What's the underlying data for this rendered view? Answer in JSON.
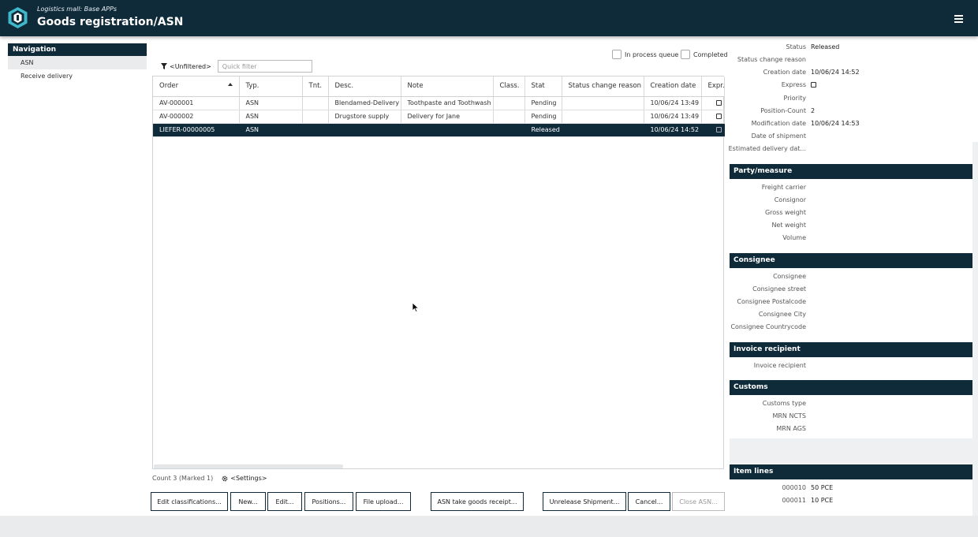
{
  "header": {
    "subtitle": "Logistics mall: Base APPs",
    "title": "Goods registration/ASN"
  },
  "navigation": {
    "heading": "Navigation",
    "items": [
      {
        "label": "ASN",
        "active": true
      },
      {
        "label": "Receive delivery",
        "active": false
      }
    ]
  },
  "filter": {
    "label": "<Unfiltered>",
    "quick_filter_placeholder": "Quick filter",
    "quick_filter_value": ""
  },
  "checkboxes": {
    "in_process_queue": {
      "label": "In process queue",
      "checked": false
    },
    "completed": {
      "label": "Completed",
      "checked": false
    }
  },
  "table": {
    "columns": [
      "Order",
      "Typ.",
      "Tnt.",
      "Desc.",
      "Note",
      "Class.",
      "Stat",
      "Status change reason",
      "Creation date",
      "Expr."
    ],
    "sort_column": "Order",
    "rows": [
      {
        "order": "AV-000001",
        "typ": "ASN",
        "tnt": "",
        "desc": "Blendamed-Delivery",
        "note": "Toothpaste and Toothwash",
        "class": "",
        "stat": "Pending",
        "reason": "",
        "created": "10/06/24 13:49",
        "express": false,
        "selected": false
      },
      {
        "order": "AV-000002",
        "typ": "ASN",
        "tnt": "",
        "desc": "Drugstore supply",
        "note": "Delivery for Jane",
        "class": "",
        "stat": "Pending",
        "reason": "",
        "created": "10/06/24 13:49",
        "express": false,
        "selected": false
      },
      {
        "order": "LIEFER-00000005",
        "typ": "ASN",
        "tnt": "",
        "desc": "",
        "note": "",
        "class": "",
        "stat": "Released",
        "reason": "",
        "created": "10/06/24 14:52",
        "express": false,
        "selected": true
      }
    ]
  },
  "count_bar": {
    "count_text": "Count 3 (Marked 1)",
    "settings_label": "<Settings>"
  },
  "buttons": {
    "edit_classifications": "Edit classifications...",
    "new": "New...",
    "edit": "Edit...",
    "positions": "Positions...",
    "file_upload": "File upload...",
    "asn_take_goods": "ASN take goods receipt...",
    "unrelease": "Unrelease Shipment...",
    "cancel": "Cancel...",
    "close_asn": "Close ASN..."
  },
  "details": {
    "status": {
      "label": "Status",
      "value": "Released"
    },
    "status_change_reason": {
      "label": "Status change reason",
      "value": ""
    },
    "creation_date": {
      "label": "Creation date",
      "value": "10/06/24 14:52"
    },
    "express": {
      "label": "Express",
      "checked": false
    },
    "priority": {
      "label": "Priority",
      "value": ""
    },
    "position_count": {
      "label": "Position-Count",
      "value": "2"
    },
    "modification_date": {
      "label": "Modification date",
      "value": "10/06/24 14:53"
    },
    "date_of_shipment": {
      "label": "Date of shipment",
      "value": ""
    },
    "estimated_delivery": {
      "label": "Estimated delivery dat...",
      "value": ""
    }
  },
  "party": {
    "heading": "Party/measure",
    "freight_carrier": "Freight carrier",
    "consignor": "Consignor",
    "gross_weight": "Gross weight",
    "net_weight": "Net weight",
    "volume": "Volume"
  },
  "consignee": {
    "heading": "Consignee",
    "consignee": "Consignee",
    "street": "Consignee street",
    "postalcode": "Consignee Postalcode",
    "city": "Consignee City",
    "countrycode": "Consignee Countrycode"
  },
  "invoice": {
    "heading": "Invoice recipient",
    "recipient": "Invoice recipient"
  },
  "customs": {
    "heading": "Customs",
    "type": "Customs type",
    "mrn_ncts": "MRN NCTS",
    "mrn_ags": "MRN AGS"
  },
  "item_lines": {
    "heading": "Item lines",
    "lines": [
      {
        "id": "000010",
        "qty": "50 PCE"
      },
      {
        "id": "000011",
        "qty": "10 PCE"
      }
    ]
  },
  "colors": {
    "primary": "#0f2b3a",
    "logo": "#3fb8c9"
  }
}
